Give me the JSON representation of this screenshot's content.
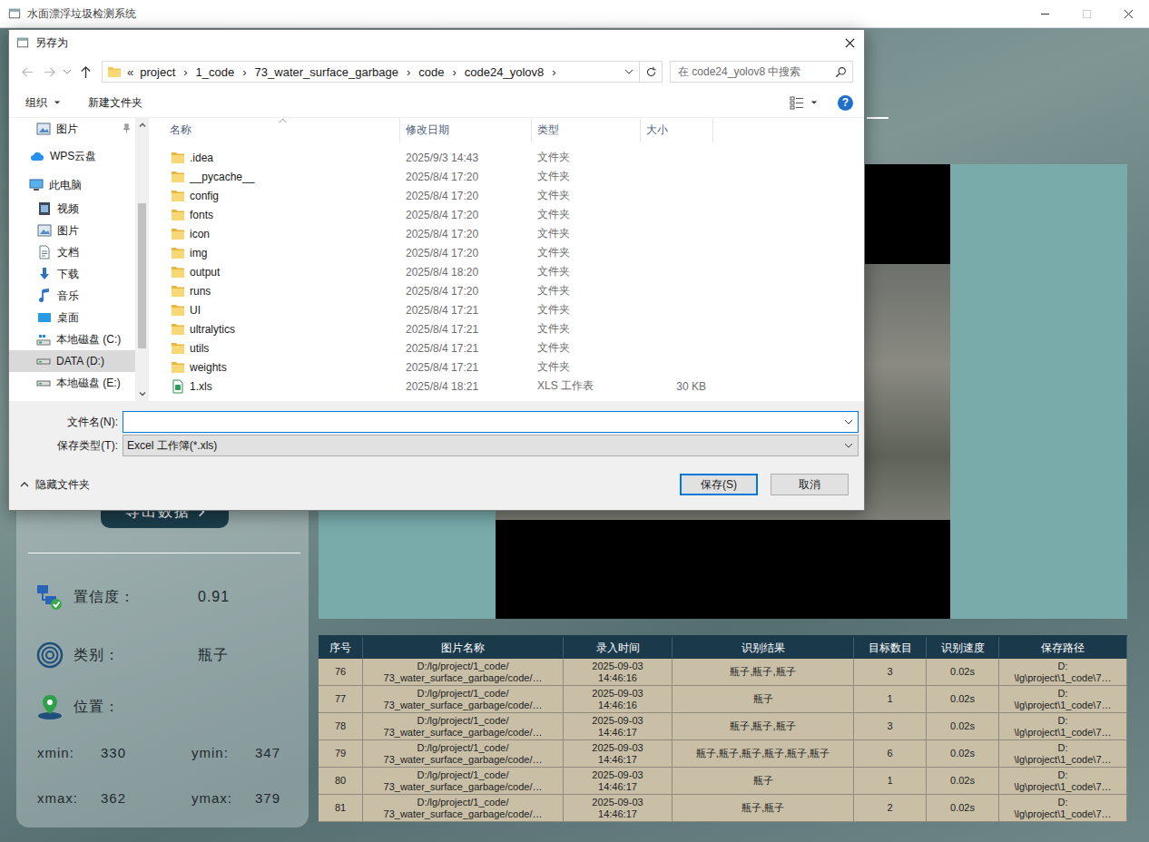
{
  "window": {
    "title": "水面漂浮垃圾检测系统",
    "maximize_disabled": true
  },
  "left_panel": {
    "export_button": "导出数据",
    "info": [
      {
        "label": "置信度：",
        "value": "0.91",
        "kind": "confidence"
      },
      {
        "label": "类别：",
        "value": "瓶子",
        "kind": "category"
      }
    ],
    "position": {
      "label": "位置：",
      "coords": [
        {
          "label": "xmin:",
          "value": "330"
        },
        {
          "label": "ymin:",
          "value": "347"
        },
        {
          "label": "xmax:",
          "value": "362"
        },
        {
          "label": "ymax:",
          "value": "379"
        }
      ]
    }
  },
  "table": {
    "columns": [
      "序号",
      "图片名称",
      "录入时间",
      "识别结果",
      "目标数目",
      "识别速度",
      "保存路径"
    ],
    "rows": [
      {
        "no": "76",
        "image": "D:/lg/project/1_code/\n73_water_surface_garbage/code/…",
        "time": "2025-09-03\n14:46:16",
        "result": "瓶子,瓶子,瓶子",
        "count": "3",
        "speed": "0.02s",
        "path": "D:\n\\lg\\project\\1_code\\7…"
      },
      {
        "no": "77",
        "image": "D:/lg/project/1_code/\n73_water_surface_garbage/code/…",
        "time": "2025-09-03\n14:46:16",
        "result": "瓶子",
        "count": "1",
        "speed": "0.02s",
        "path": "D:\n\\lg\\project\\1_code\\7…"
      },
      {
        "no": "78",
        "image": "D:/lg/project/1_code/\n73_water_surface_garbage/code/…",
        "time": "2025-09-03\n14:46:17",
        "result": "瓶子,瓶子,瓶子",
        "count": "3",
        "speed": "0.02s",
        "path": "D:\n\\lg\\project\\1_code\\7…"
      },
      {
        "no": "79",
        "image": "D:/lg/project/1_code/\n73_water_surface_garbage/code/…",
        "time": "2025-09-03\n14:46:17",
        "result": "瓶子,瓶子,瓶子,瓶子,瓶子,瓶子",
        "count": "6",
        "speed": "0.02s",
        "path": "D:\n\\lg\\project\\1_code\\7…"
      },
      {
        "no": "80",
        "image": "D:/lg/project/1_code/\n73_water_surface_garbage/code/…",
        "time": "2025-09-03\n14:46:17",
        "result": "瓶子",
        "count": "1",
        "speed": "0.02s",
        "path": "D:\n\\lg\\project\\1_code\\7…"
      },
      {
        "no": "81",
        "image": "D:/lg/project/1_code/\n73_water_surface_garbage/code/…",
        "time": "2025-09-03\n14:46:17",
        "result": "瓶子,瓶子",
        "count": "2",
        "speed": "0.02s",
        "path": "D:\n\\lg\\project\\1_code\\7…"
      }
    ]
  },
  "dialog": {
    "title": "另存为",
    "nav_buttons": {
      "back_disabled": true,
      "forward_disabled": true,
      "up_disabled": false
    },
    "breadcrumb": {
      "prefix": "«",
      "separator": "›",
      "items": [
        "project",
        "1_code",
        "73_water_surface_garbage",
        "code",
        "code24_yolov8"
      ]
    },
    "search": {
      "placeholder": "在 code24_yolov8 中搜索"
    },
    "toolbar": {
      "organize": "组织",
      "new_folder": "新建文件夹",
      "help": "?"
    },
    "nav": [
      {
        "label": "图片",
        "kind": "pictures",
        "pinned": true,
        "selected": false
      },
      {
        "label": "WPS云盘",
        "kind": "cloud",
        "pinned": false,
        "selected": false
      },
      {
        "label": "此电脑",
        "kind": "pc",
        "pinned": false,
        "selected": false
      },
      {
        "label": "视频",
        "kind": "videos",
        "pinned": false,
        "selected": false
      },
      {
        "label": "图片",
        "kind": "pictures",
        "pinned": false,
        "selected": false
      },
      {
        "label": "文档",
        "kind": "docs",
        "pinned": false,
        "selected": false
      },
      {
        "label": "下载",
        "kind": "downloads",
        "pinned": false,
        "selected": false
      },
      {
        "label": "音乐",
        "kind": "music",
        "pinned": false,
        "selected": false
      },
      {
        "label": "桌面",
        "kind": "desktop",
        "pinned": false,
        "selected": false
      },
      {
        "label": "本地磁盘 (C:)",
        "kind": "system-drive",
        "pinned": false,
        "selected": false
      },
      {
        "label": "DATA (D:)",
        "kind": "drive",
        "pinned": false,
        "selected": true
      },
      {
        "label": "本地磁盘 (E:)",
        "kind": "drive",
        "pinned": false,
        "selected": false
      }
    ],
    "columns": [
      "名称",
      "修改日期",
      "类型",
      "大小"
    ],
    "files": [
      {
        "name": ".idea",
        "date": "2025/9/3 14:43",
        "type": "文件夹",
        "size": "",
        "kind": "folder"
      },
      {
        "name": "__pycache__",
        "date": "2025/8/4 17:20",
        "type": "文件夹",
        "size": "",
        "kind": "folder"
      },
      {
        "name": "config",
        "date": "2025/8/4 17:20",
        "type": "文件夹",
        "size": "",
        "kind": "folder"
      },
      {
        "name": "fonts",
        "date": "2025/8/4 17:20",
        "type": "文件夹",
        "size": "",
        "kind": "folder"
      },
      {
        "name": "icon",
        "date": "2025/8/4 17:20",
        "type": "文件夹",
        "size": "",
        "kind": "folder"
      },
      {
        "name": "img",
        "date": "2025/8/4 17:20",
        "type": "文件夹",
        "size": "",
        "kind": "folder"
      },
      {
        "name": "output",
        "date": "2025/8/4 18:20",
        "type": "文件夹",
        "size": "",
        "kind": "folder"
      },
      {
        "name": "runs",
        "date": "2025/8/4 17:20",
        "type": "文件夹",
        "size": "",
        "kind": "folder"
      },
      {
        "name": "UI",
        "date": "2025/8/4 17:21",
        "type": "文件夹",
        "size": "",
        "kind": "folder"
      },
      {
        "name": "ultralytics",
        "date": "2025/8/4 17:21",
        "type": "文件夹",
        "size": "",
        "kind": "folder"
      },
      {
        "name": "utils",
        "date": "2025/8/4 17:21",
        "type": "文件夹",
        "size": "",
        "kind": "folder"
      },
      {
        "name": "weights",
        "date": "2025/8/4 17:21",
        "type": "文件夹",
        "size": "",
        "kind": "folder"
      },
      {
        "name": "1.xls",
        "date": "2025/8/4 18:21",
        "type": "XLS 工作表",
        "size": "30 KB",
        "kind": "xls"
      }
    ],
    "file_name": {
      "label": "文件名(N):",
      "value": "",
      "focused": true
    },
    "file_type": {
      "label": "保存类型(T):",
      "value": "Excel 工作簿(*.xls)"
    },
    "hide_folders": "隐藏文件夹",
    "buttons": [
      {
        "label": "保存(S)",
        "default": true
      },
      {
        "label": "取消",
        "default": false
      }
    ]
  }
}
